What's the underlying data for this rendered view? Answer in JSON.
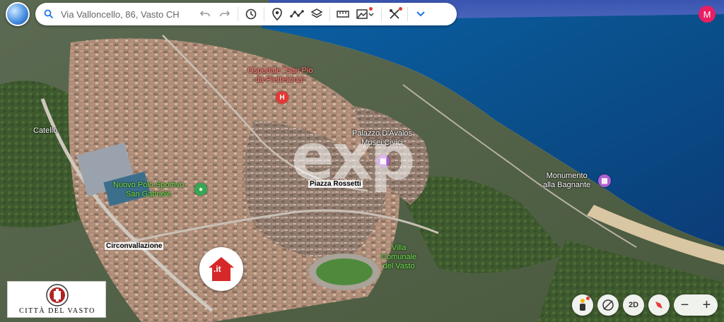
{
  "search": {
    "query": "Via Valloncello, 86, Vasto CH"
  },
  "user": {
    "avatar_initial": "M"
  },
  "map_labels": {
    "hospital": "Ospedale \"San Pio da Pietrelcina\"",
    "hospital_line1": "Ospedale \"San Pio",
    "hospital_line2": "da Pietrelcina\"",
    "catello": "Catello",
    "palazzo_line1": "Palazzo D'Avalos",
    "palazzo_line2": "Musei Civici",
    "monumento_line1": "Monumento",
    "monumento_line2": "alla Bagnante",
    "polo_line1": "Nuovo Polo Sportivo",
    "polo_line2": "San Gabriele",
    "piazza": "Piazza Rossetti",
    "circonvallazione": "Circonvallazione",
    "villa_line1": "Villa",
    "villa_line2": "Comunale",
    "villa_line3": "del Vasto"
  },
  "watermark": {
    "text": "exp"
  },
  "badge": {
    "text": ".it"
  },
  "logo": {
    "text": "CITTÀ DEL VASTO"
  },
  "controls": {
    "view_2d": "2D",
    "zoom_out": "−",
    "zoom_in": "+"
  },
  "colors": {
    "accent": "#1a73e8",
    "avatar": "#e91e63",
    "hospital": "#e53935",
    "museum": "#b05fd0",
    "sport": "#34a853",
    "sea": "#0a5a9a"
  }
}
